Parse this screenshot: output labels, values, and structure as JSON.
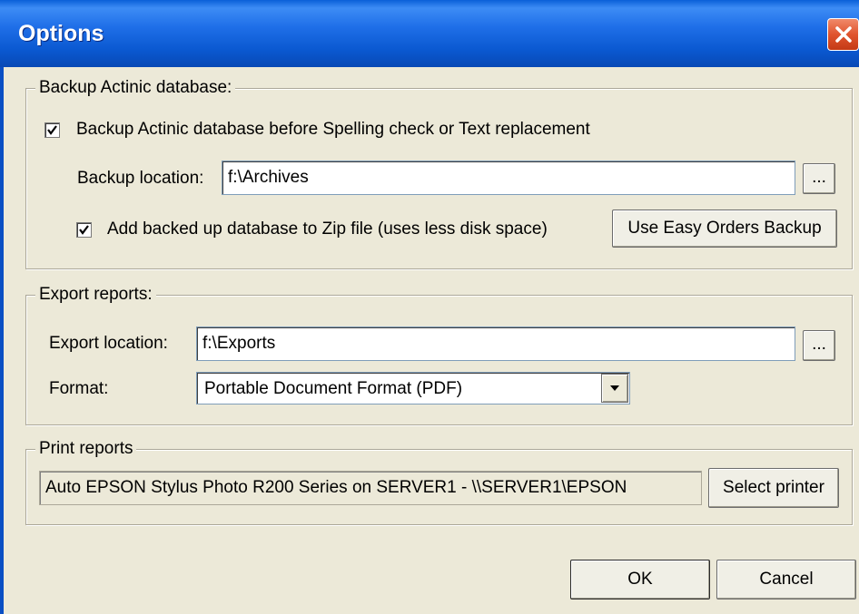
{
  "window": {
    "title": "Options"
  },
  "backup": {
    "group_label": "Backup Actinic database:",
    "checkbox_before": "Backup Actinic database before Spelling check or Text replacement",
    "checkbox_before_checked": true,
    "location_label": "Backup location:",
    "location_value": "f:\\Archives",
    "browse_label": "...",
    "zip_label": "Add backed up database to Zip file (uses less disk space)",
    "zip_checked": true,
    "easy_orders_button": "Use Easy Orders Backup"
  },
  "export": {
    "group_label": "Export reports:",
    "location_label": "Export location:",
    "location_value": "f:\\Exports",
    "browse_label": "...",
    "format_label": "Format:",
    "format_value": "Portable Document Format (PDF)"
  },
  "print": {
    "group_label": "Print reports",
    "printer_value": "Auto EPSON Stylus Photo R200 Series on SERVER1  -  \\\\SERVER1\\EPSON",
    "select_printer_button": "Select printer"
  },
  "footer": {
    "ok_label": "OK",
    "cancel_label": "Cancel"
  },
  "colors": {
    "title_bar": "#0a58d0",
    "dialog_bg": "#ece9d8",
    "close_button": "#e0542e"
  }
}
